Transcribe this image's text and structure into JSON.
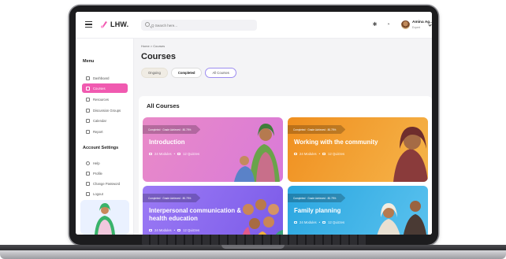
{
  "app": {
    "logo_text": "LHW."
  },
  "search": {
    "placeholder": "Q Search here..."
  },
  "user": {
    "name": "Amina Ag..",
    "role": "Expert"
  },
  "sidebar": {
    "menu_heading": "Menu",
    "items": [
      {
        "label": "Dashboard",
        "active": false
      },
      {
        "label": "Courses",
        "active": true
      },
      {
        "label": "Resources",
        "active": false
      },
      {
        "label": "Discussion Groups",
        "active": false
      },
      {
        "label": "Calendar",
        "active": false
      },
      {
        "label": "Report",
        "active": false
      }
    ],
    "settings_heading": "Account Settings",
    "settings_items": [
      {
        "label": "Help"
      },
      {
        "label": "Profile"
      },
      {
        "label": "Change Password"
      },
      {
        "label": "Logout"
      }
    ]
  },
  "main": {
    "breadcrumb": "Home > Courses",
    "page_title": "Courses",
    "tabs": [
      "Ongoing",
      "Completed",
      "All Courses"
    ],
    "section_title": "All Courses",
    "cards": [
      {
        "ribbon": "Completed · Grade Achieved : 80.75%",
        "title": "Introduction",
        "modules": "24 Modules",
        "quizzes": "12 Quizzes",
        "color": "#e98ac8"
      },
      {
        "ribbon": "Completed · Grade Achieved : 80.75%",
        "title": "Working with the community",
        "modules": "24 Modules",
        "quizzes": "12 Quizzes",
        "color": "#f2a033"
      },
      {
        "ribbon": "Completed · Grade Achieved : 80.75%",
        "title": "Interpersonal communication & health education",
        "modules": "24 Modules",
        "quizzes": "12 Quizzes",
        "color": "#8d6df0"
      },
      {
        "ribbon": "Completed · Grade Achieved : 80.75%",
        "title": "Family planning",
        "modules": "24 Modules",
        "quizzes": "12 Quizzes",
        "color": "#3db5e8"
      }
    ]
  },
  "colors": {
    "accent": "#f05ab0",
    "tab_outline": "#9c8cf0"
  }
}
